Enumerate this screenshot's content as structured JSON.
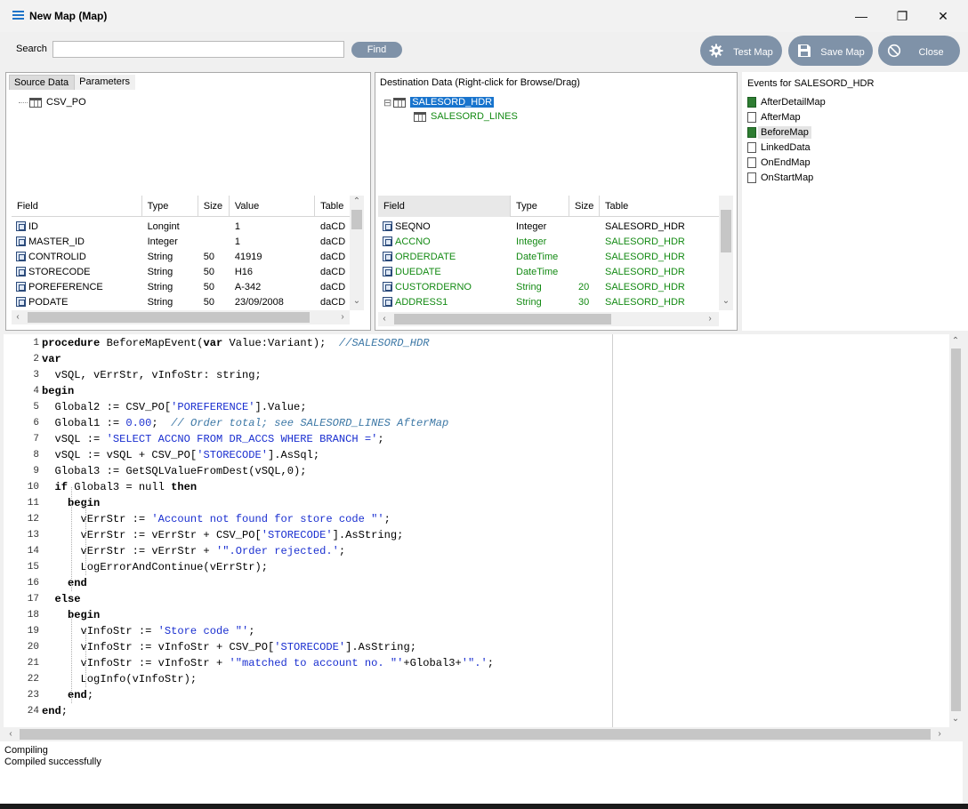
{
  "window": {
    "title": "New Map (Map)",
    "min_glyph": "—",
    "max_glyph": "❐",
    "close_glyph": "✕"
  },
  "toolbar": {
    "search_label": "Search",
    "search_value": "",
    "find_label": "Find",
    "test_map_label": "Test Map",
    "save_map_label": "Save Map",
    "close_label": "Close"
  },
  "source": {
    "tabs": [
      "Source Data",
      "Parameters"
    ],
    "tree_root": "CSV_PO",
    "columns": [
      "Field",
      "Type",
      "Size",
      "Value",
      "Table"
    ],
    "rows": [
      {
        "field": "ID",
        "type": "Longint",
        "size": "",
        "value": "1",
        "table": "daCD"
      },
      {
        "field": "MASTER_ID",
        "type": "Integer",
        "size": "",
        "value": "1",
        "table": "daCD"
      },
      {
        "field": "CONTROLID",
        "type": "String",
        "size": "50",
        "value": "41919",
        "table": "daCD"
      },
      {
        "field": "STORECODE",
        "type": "String",
        "size": "50",
        "value": "H16",
        "table": "daCD"
      },
      {
        "field": "POREFERENCE",
        "type": "String",
        "size": "50",
        "value": "A-342",
        "table": "daCD"
      },
      {
        "field": "PODATE",
        "type": "String",
        "size": "50",
        "value": "23/09/2008",
        "table": "daCD"
      }
    ]
  },
  "destination": {
    "caption": "Destination Data  (Right-click for Browse/Drag)",
    "tree_root": "SALESORD_HDR",
    "tree_child": "SALESORD_LINES",
    "tree_toggle": "⊟",
    "columns": [
      "Field",
      "Type",
      "Size",
      "Table"
    ],
    "rows": [
      {
        "field": "SEQNO",
        "type": "Integer",
        "size": "",
        "table": "SALESORD_HDR",
        "green": false
      },
      {
        "field": "ACCNO",
        "type": "Integer",
        "size": "",
        "table": "SALESORD_HDR",
        "green": true
      },
      {
        "field": "ORDERDATE",
        "type": "DateTime",
        "size": "",
        "table": "SALESORD_HDR",
        "green": true
      },
      {
        "field": "DUEDATE",
        "type": "DateTime",
        "size": "",
        "table": "SALESORD_HDR",
        "green": true
      },
      {
        "field": "CUSTORDERNO",
        "type": "String",
        "size": "20",
        "table": "SALESORD_HDR",
        "green": true
      },
      {
        "field": "ADDRESS1",
        "type": "String",
        "size": "30",
        "table": "SALESORD_HDR",
        "green": true
      }
    ]
  },
  "events": {
    "title": "Events for SALESORD_HDR",
    "items": [
      {
        "label": "AfterDetailMap",
        "filled": true,
        "selected": false
      },
      {
        "label": "AfterMap",
        "filled": false,
        "selected": false
      },
      {
        "label": "BeforeMap",
        "filled": true,
        "selected": true
      },
      {
        "label": "LinkedData",
        "filled": false,
        "selected": false
      },
      {
        "label": "OnEndMap",
        "filled": false,
        "selected": false
      },
      {
        "label": "OnStartMap",
        "filled": false,
        "selected": false
      }
    ]
  },
  "code": {
    "lines": [
      [
        [
          "kw",
          "procedure"
        ],
        [
          "t",
          " BeforeMapEvent("
        ],
        [
          "kw",
          "var"
        ],
        [
          "t",
          " Value:Variant);  "
        ],
        [
          "cmt",
          "//SALESORD_HDR"
        ]
      ],
      [
        [
          "kw",
          "var"
        ]
      ],
      [
        [
          "t",
          "  vSQL, vErrStr, vInfoStr: string;"
        ]
      ],
      [
        [
          "kw",
          "begin"
        ]
      ],
      [
        [
          "t",
          "  Global2 := CSV_PO["
        ],
        [
          "str",
          "'POREFERENCE'"
        ],
        [
          "t",
          "].Value;"
        ]
      ],
      [
        [
          "t",
          "  Global1 := "
        ],
        [
          "str",
          "0.00"
        ],
        [
          "t",
          ";  "
        ],
        [
          "cmt",
          "// Order total; see SALESORD_LINES AfterMap"
        ]
      ],
      [
        [
          "t",
          "  vSQL := "
        ],
        [
          "str",
          "'SELECT ACCNO FROM DR_ACCS WHERE BRANCH ='"
        ],
        [
          "t",
          ";"
        ]
      ],
      [
        [
          "t",
          "  vSQL := vSQL + CSV_PO["
        ],
        [
          "str",
          "'STORECODE'"
        ],
        [
          "t",
          "].AsSql;"
        ]
      ],
      [
        [
          "t",
          "  Global3 := GetSQLValueFromDest(vSQL,0);"
        ]
      ],
      [
        [
          "t",
          "  "
        ],
        [
          "kw",
          "if"
        ],
        [
          "t",
          " Global3 = null "
        ],
        [
          "kw",
          "then"
        ]
      ],
      [
        [
          "t",
          "    "
        ],
        [
          "kw",
          "begin"
        ]
      ],
      [
        [
          "t",
          "      vErrStr := "
        ],
        [
          "str",
          "'Account not found for store code \"'"
        ],
        [
          "t",
          ";"
        ]
      ],
      [
        [
          "t",
          "      vErrStr := vErrStr + CSV_PO["
        ],
        [
          "str",
          "'STORECODE'"
        ],
        [
          "t",
          "].AsString;"
        ]
      ],
      [
        [
          "t",
          "      vErrStr := vErrStr + "
        ],
        [
          "str",
          "'\".Order rejected.'"
        ],
        [
          "t",
          ";"
        ]
      ],
      [
        [
          "t",
          "      LogErrorAndContinue(vErrStr);"
        ]
      ],
      [
        [
          "t",
          "    "
        ],
        [
          "kw",
          "end"
        ]
      ],
      [
        [
          "t",
          "  "
        ],
        [
          "kw",
          "else"
        ]
      ],
      [
        [
          "t",
          "    "
        ],
        [
          "kw",
          "begin"
        ]
      ],
      [
        [
          "t",
          "      vInfoStr := "
        ],
        [
          "str",
          "'Store code \"'"
        ],
        [
          "t",
          ";"
        ]
      ],
      [
        [
          "t",
          "      vInfoStr := vInfoStr + CSV_PO["
        ],
        [
          "str",
          "'STORECODE'"
        ],
        [
          "t",
          "].AsString;"
        ]
      ],
      [
        [
          "t",
          "      vInfoStr := vInfoStr + "
        ],
        [
          "str",
          "'\"matched to account no. \"'"
        ],
        [
          "t",
          "+Global3+"
        ],
        [
          "str",
          "'\".'"
        ],
        [
          "t",
          ";"
        ]
      ],
      [
        [
          "t",
          "      LogInfo(vInfoStr);"
        ]
      ],
      [
        [
          "t",
          "    "
        ],
        [
          "kw",
          "end"
        ],
        [
          "t",
          ";"
        ]
      ],
      [
        [
          "kw",
          "end"
        ],
        [
          "t",
          ";"
        ]
      ]
    ]
  },
  "output": {
    "lines": [
      "Compiling",
      "Compiled successfully"
    ]
  },
  "scroll_glyphs": {
    "up": "⌃",
    "down": "⌄",
    "left": "‹",
    "right": "›"
  }
}
